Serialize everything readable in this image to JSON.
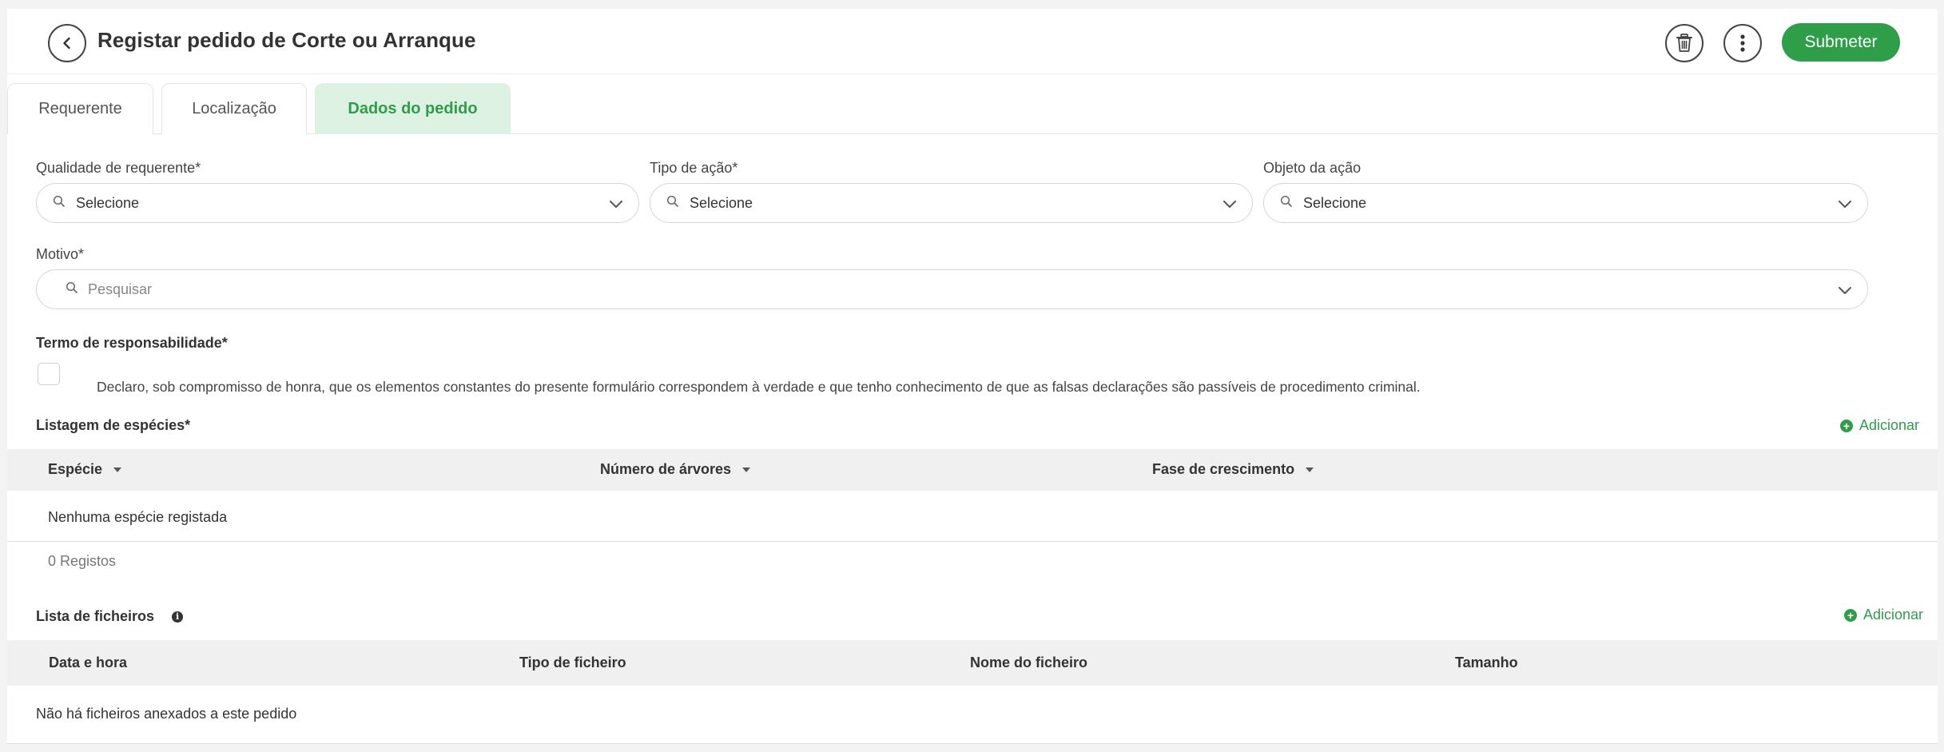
{
  "header": {
    "title": "Registar pedido de Corte ou Arranque",
    "submit_label": "Submeter",
    "icons": [
      "chevron-left-icon",
      "trash-icon",
      "more-vertical-icon"
    ]
  },
  "tabs": [
    {
      "label": "Requerente",
      "active": false
    },
    {
      "label": "Localização",
      "active": false
    },
    {
      "label": "Dados do pedido",
      "active": true
    }
  ],
  "form": {
    "qualidade": {
      "label": "Qualidade de requerente*",
      "value": "Selecione"
    },
    "tipo_acao": {
      "label": "Tipo de ação*",
      "value": "Selecione"
    },
    "objeto_acao": {
      "label": "Objeto da ação",
      "value": "Selecione"
    },
    "motivo": {
      "label": "Motivo*",
      "placeholder": "Pesquisar"
    },
    "termo": {
      "title": "Termo de responsabilidade*",
      "declaration": "Declaro, sob compromisso de honra, que os elementos constantes do presente formulário correspondem à verdade e que tenho conhecimento de que as falsas declarações são passíveis de procedimento criminal.",
      "checked": false
    }
  },
  "species": {
    "title": "Listagem de espécies*",
    "add_label": "Adicionar",
    "columns": [
      "Espécie",
      "Número de árvores",
      "Fase de crescimento"
    ],
    "empty_text": "Nenhuma espécie registada",
    "records_label": "0 Registos"
  },
  "files": {
    "title": "Lista de ficheiros",
    "add_label": "Adicionar",
    "columns": [
      "Data e hora",
      "Tipo de ficheiro",
      "Nome do ficheiro",
      "Tamanho"
    ],
    "empty_text": "Não há ficheiros anexados a este pedido"
  },
  "colors": {
    "accent": "#2e9e48",
    "tab_active_bg": "#ddf2e2",
    "table_header_bg": "#f0f0f0"
  }
}
